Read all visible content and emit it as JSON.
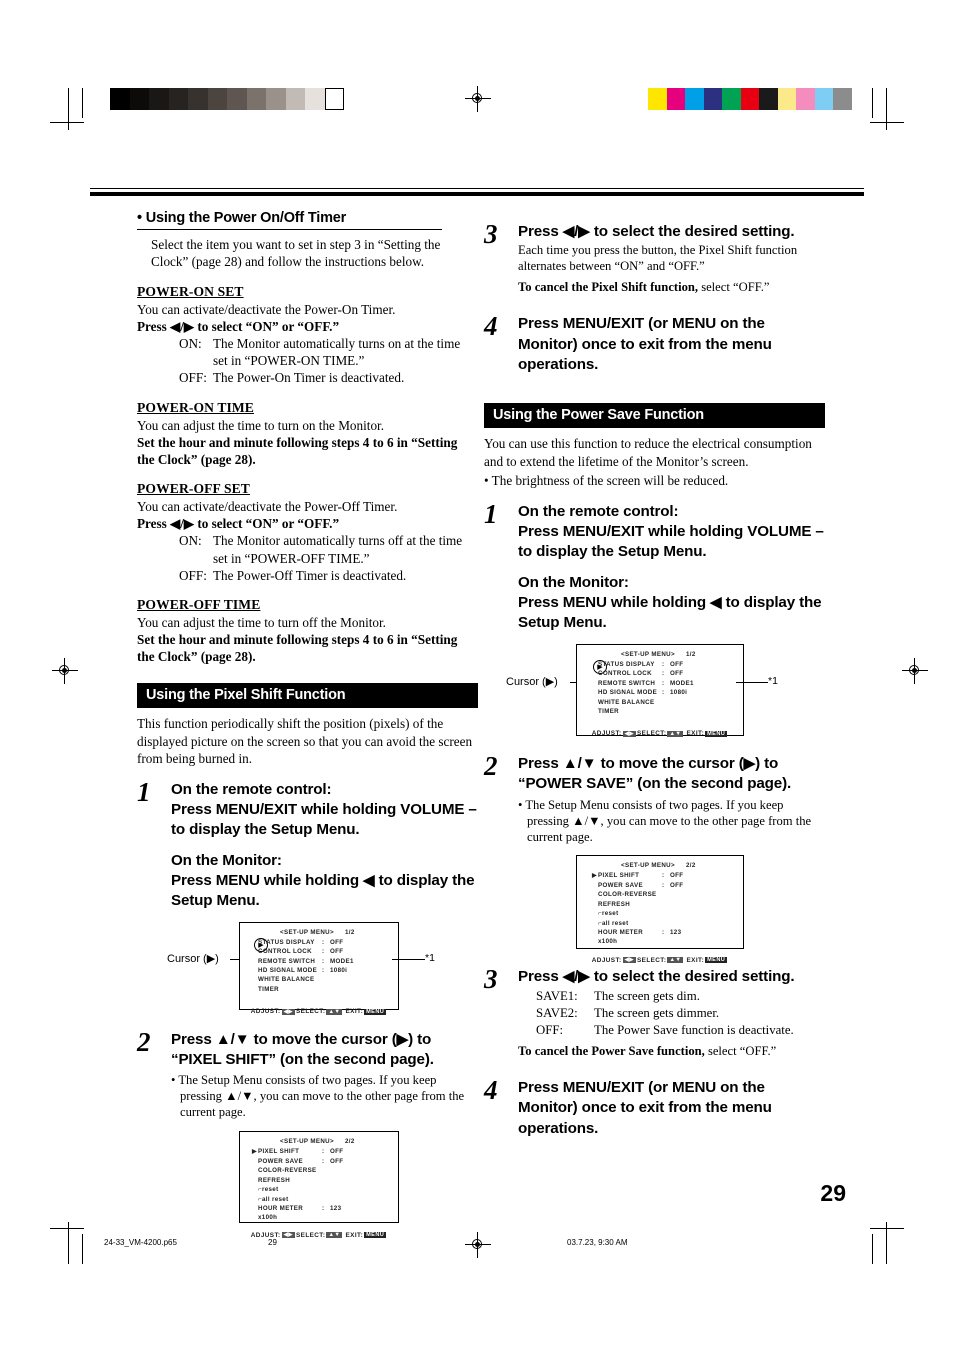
{
  "page": {
    "number": "29",
    "footer": {
      "filename": "24-33_VM-4200.p65",
      "page": "29",
      "timestamp": "03.7.23, 9:30 AM"
    }
  },
  "colorbars": {
    "gray_label": "grayscale-step-wedge",
    "gray": [
      "#000000",
      "#0d0b0a",
      "#1b1715",
      "#272320",
      "#38322e",
      "#4b443f",
      "#5f5651",
      "#7b726c",
      "#9a918b",
      "#c2bab4",
      "#e6e1dd",
      "#ffffff"
    ],
    "colors": [
      "#ffe600",
      "#e6007e",
      "#00a0e9",
      "#2b3180",
      "#00a353",
      "#e60012",
      "#1a1a1a",
      "#fbe98a",
      "#f58cbe",
      "#7dcdf4",
      "#8c8c8c"
    ]
  },
  "left_column": {
    "timer_section": {
      "heading": "• Using the Power On/Off Timer",
      "intro": "Select the item you want to set in step 3 in “Setting the Clock” (page 28) and follow the instructions below.",
      "entries": [
        {
          "title": "POWER-ON SET",
          "line1": "You can activate/deactivate the Power-On Timer.",
          "line2": "Press ◀/▶ to select “ON” or “OFF.”",
          "on_label": "ON:",
          "on_text": "The Monitor automatically turns on at the time set in “POWER-ON TIME.”",
          "off_label": "OFF:",
          "off_text": "The Power-On Timer is deactivated."
        },
        {
          "title": "POWER-ON TIME",
          "line1": "You can adjust the time to turn on the Monitor.",
          "line2": "Set the hour and minute following steps 4 to 6 in “Setting the Clock” (page 28)."
        },
        {
          "title": "POWER-OFF SET",
          "line1": "You can activate/deactivate the Power-Off Timer.",
          "line2": "Press ◀/▶ to select “ON” or “OFF.”",
          "on_label": "ON:",
          "on_text": "The Monitor automatically turns off at the time set in “POWER-OFF TIME.”",
          "off_label": "OFF:",
          "off_text": "The Power-Off Timer is deactivated."
        },
        {
          "title": "POWER-OFF TIME",
          "line1": "You can adjust the time to turn off the Monitor.",
          "line2": "Set the hour and minute following steps 4 to 6 in “Setting the Clock” (page 28)."
        }
      ]
    },
    "pixel_shift": {
      "banner": "Using the Pixel Shift Function",
      "intro": "This function periodically shift the position (pixels) of the displayed picture on the screen so that you can avoid the screen from being burned in.",
      "step1": {
        "num": "1",
        "remote_head": "On the remote control:",
        "remote_text": "Press MENU/EXIT while holding VOLUME – to display the Setup Menu.",
        "monitor_head": "On the Monitor:",
        "monitor_text": "Press MENU while holding ◀ to display the Setup Menu."
      },
      "step2": {
        "num": "2",
        "title": "Press ▲/▼ to move the cursor (▶) to “PIXEL SHIFT” (on the second page).",
        "bullet": "• The Setup Menu consists of two pages. If you keep pressing ▲/▼, you can move to the other page from the current page."
      }
    }
  },
  "right_column": {
    "pixel_shift_cont": {
      "step3": {
        "num": "3",
        "title": "Press ◀/▶ to select the desired setting.",
        "note": "Each time you press the button, the Pixel Shift function alternates between “ON” and “OFF.”",
        "cancel_bold": "To cancel the Pixel Shift function,",
        "cancel_rest": " select “OFF.”"
      },
      "step4": {
        "num": "4",
        "title": "Press MENU/EXIT (or MENU on the Monitor) once to exit from the menu operations."
      }
    },
    "power_save": {
      "banner": "Using the Power Save Function",
      "intro": "You can use this function to reduce the electrical consumption and to extend the lifetime of the Monitor’s screen.",
      "intro_bullet": "• The brightness of the screen will be reduced.",
      "step1": {
        "num": "1",
        "remote_head": "On the remote control:",
        "remote_text": "Press MENU/EXIT while holding VOLUME – to display the Setup Menu.",
        "monitor_head": "On the Monitor:",
        "monitor_text": "Press MENU while holding ◀ to display the Setup Menu."
      },
      "step2": {
        "num": "2",
        "title": "Press ▲/▼ to move the cursor (▶) to “POWER SAVE” (on the second page).",
        "bullet": "• The Setup Menu consists of two pages. If you keep pressing ▲/▼, you can move to the other page from the current page."
      },
      "step3": {
        "num": "3",
        "title": "Press ◀/▶ to select the desired setting.",
        "options": [
          {
            "key": "SAVE1:",
            "text": "The screen gets dim."
          },
          {
            "key": "SAVE2:",
            "text": "The screen gets dimmer."
          },
          {
            "key": "OFF:",
            "text": "The Power Save function is deactivate."
          }
        ],
        "cancel_bold": "To cancel the Power Save function,",
        "cancel_rest": " select “OFF.”"
      },
      "step4": {
        "num": "4",
        "title": "Press MENU/EXIT (or MENU on the Monitor) once to exit from the menu operations."
      }
    }
  },
  "osd": {
    "cursor_label": "Cursor (▶)",
    "star_note": "*1",
    "page1": {
      "title": "<SET-UP MENU>",
      "page_indicator": "1/2",
      "rows": [
        {
          "name": "STATUS DISPLAY",
          "colon": ":",
          "value": "OFF"
        },
        {
          "name": "CONTROL LOCK",
          "colon": ":",
          "value": "OFF"
        },
        {
          "name": "REMOTE SWITCH",
          "colon": ":",
          "value": "MODE1"
        },
        {
          "name": "HD SIGNAL MODE",
          "colon": ":",
          "value": "1080i"
        },
        {
          "name": "WHITE BALANCE",
          "colon": "",
          "value": ""
        },
        {
          "name": "TIMER",
          "colon": "",
          "value": ""
        }
      ],
      "footer_adjust": "ADJUST:",
      "footer_select": "SELECT:",
      "footer_exit": "EXIT:",
      "footer_exit_key": "MENU"
    },
    "page2": {
      "title": "<SET-UP MENU>",
      "page_indicator": "2/2",
      "rows": [
        {
          "name": "PIXEL SHIFT",
          "colon": ":",
          "value": "OFF",
          "cursor": true
        },
        {
          "name": "POWER SAVE",
          "colon": ":",
          "value": "OFF"
        },
        {
          "name": "COLOR-REVERSE",
          "colon": "",
          "value": ""
        },
        {
          "name": "REFRESH",
          "colon": "",
          "value": ""
        },
        {
          "name": "⌐reset",
          "colon": "",
          "value": ""
        },
        {
          "name": "⌐all reset",
          "colon": "",
          "value": ""
        },
        {
          "name": "HOUR METER x100h",
          "colon": ":",
          "value": "123"
        }
      ],
      "footer_adjust": "ADJUST:",
      "footer_select": "SELECT:",
      "footer_exit": "EXIT:",
      "footer_exit_key": "MENU"
    }
  }
}
